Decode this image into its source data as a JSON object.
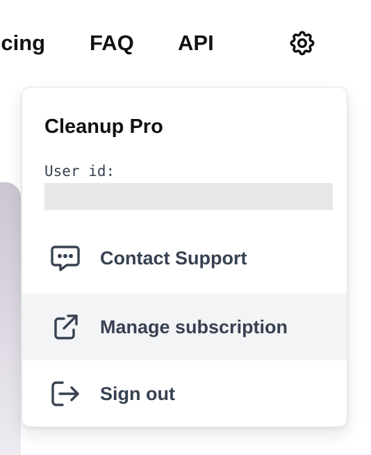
{
  "nav": {
    "links": [
      {
        "label": "Pricing"
      },
      {
        "label": "FAQ"
      },
      {
        "label": "API"
      }
    ],
    "settings_icon": "gear-icon"
  },
  "popover": {
    "plan_title": "Cleanup Pro",
    "user_id_label": "User id:",
    "user_id_value": "",
    "items": [
      {
        "label": "Contact Support",
        "icon": "chat-bubble-icon"
      },
      {
        "label": "Manage subscription",
        "icon": "external-link-icon"
      },
      {
        "label": "Sign out",
        "icon": "sign-out-icon"
      }
    ]
  },
  "colors": {
    "text_primary": "#111111",
    "menu_text": "#374151",
    "hover_bg": "#f3f4f6",
    "user_id_bg": "#e8e8e8",
    "popover_border": "#e5e7eb"
  }
}
